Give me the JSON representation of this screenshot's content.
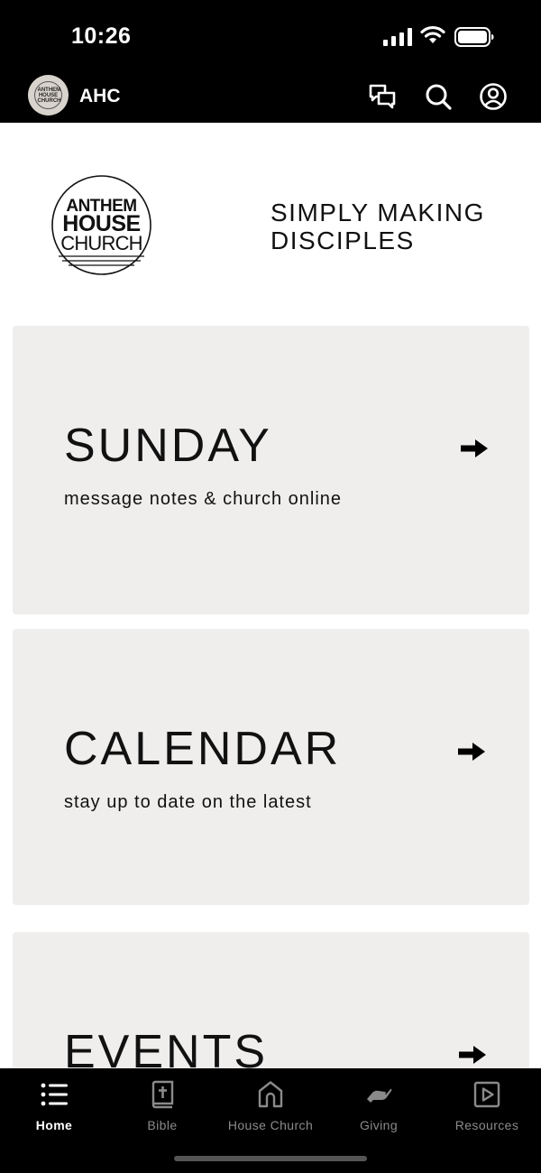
{
  "status_bar": {
    "time": "10:26",
    "signal_icon": "cellular-signal-icon",
    "wifi_icon": "wifi-icon",
    "battery_icon": "battery-icon"
  },
  "header": {
    "avatar_text": "ANTHEM HOUSE CHURCH",
    "title": "AHC",
    "icons": [
      "messages-icon",
      "search-icon",
      "profile-icon"
    ]
  },
  "brand": {
    "logo_lines": [
      "ANTHEM",
      "HOUSE",
      "CHURCH"
    ],
    "tagline_line1": "SIMPLY MAKING",
    "tagline_line2": "DISCIPLES"
  },
  "cards": [
    {
      "title": "SUNDAY",
      "subtitle": "message notes & church online",
      "icon": "arrow-right-icon"
    },
    {
      "title": "CALENDAR",
      "subtitle": "stay up to date on the latest",
      "icon": "arrow-right-icon"
    },
    {
      "title": "EVENTS",
      "icon": "arrow-right-icon"
    }
  ],
  "tabs": [
    {
      "label": "Home",
      "icon": "list-icon",
      "active": true
    },
    {
      "label": "Bible",
      "icon": "bible-icon",
      "active": false
    },
    {
      "label": "House Church",
      "icon": "house-icon",
      "active": false
    },
    {
      "label": "Giving",
      "icon": "giving-hand-icon",
      "active": false
    },
    {
      "label": "Resources",
      "icon": "play-box-icon",
      "active": false
    }
  ],
  "colors": {
    "background": "#000000",
    "card": "#efeeed",
    "tab_inactive": "#8a8a8a",
    "tab_active": "#ffffff"
  }
}
